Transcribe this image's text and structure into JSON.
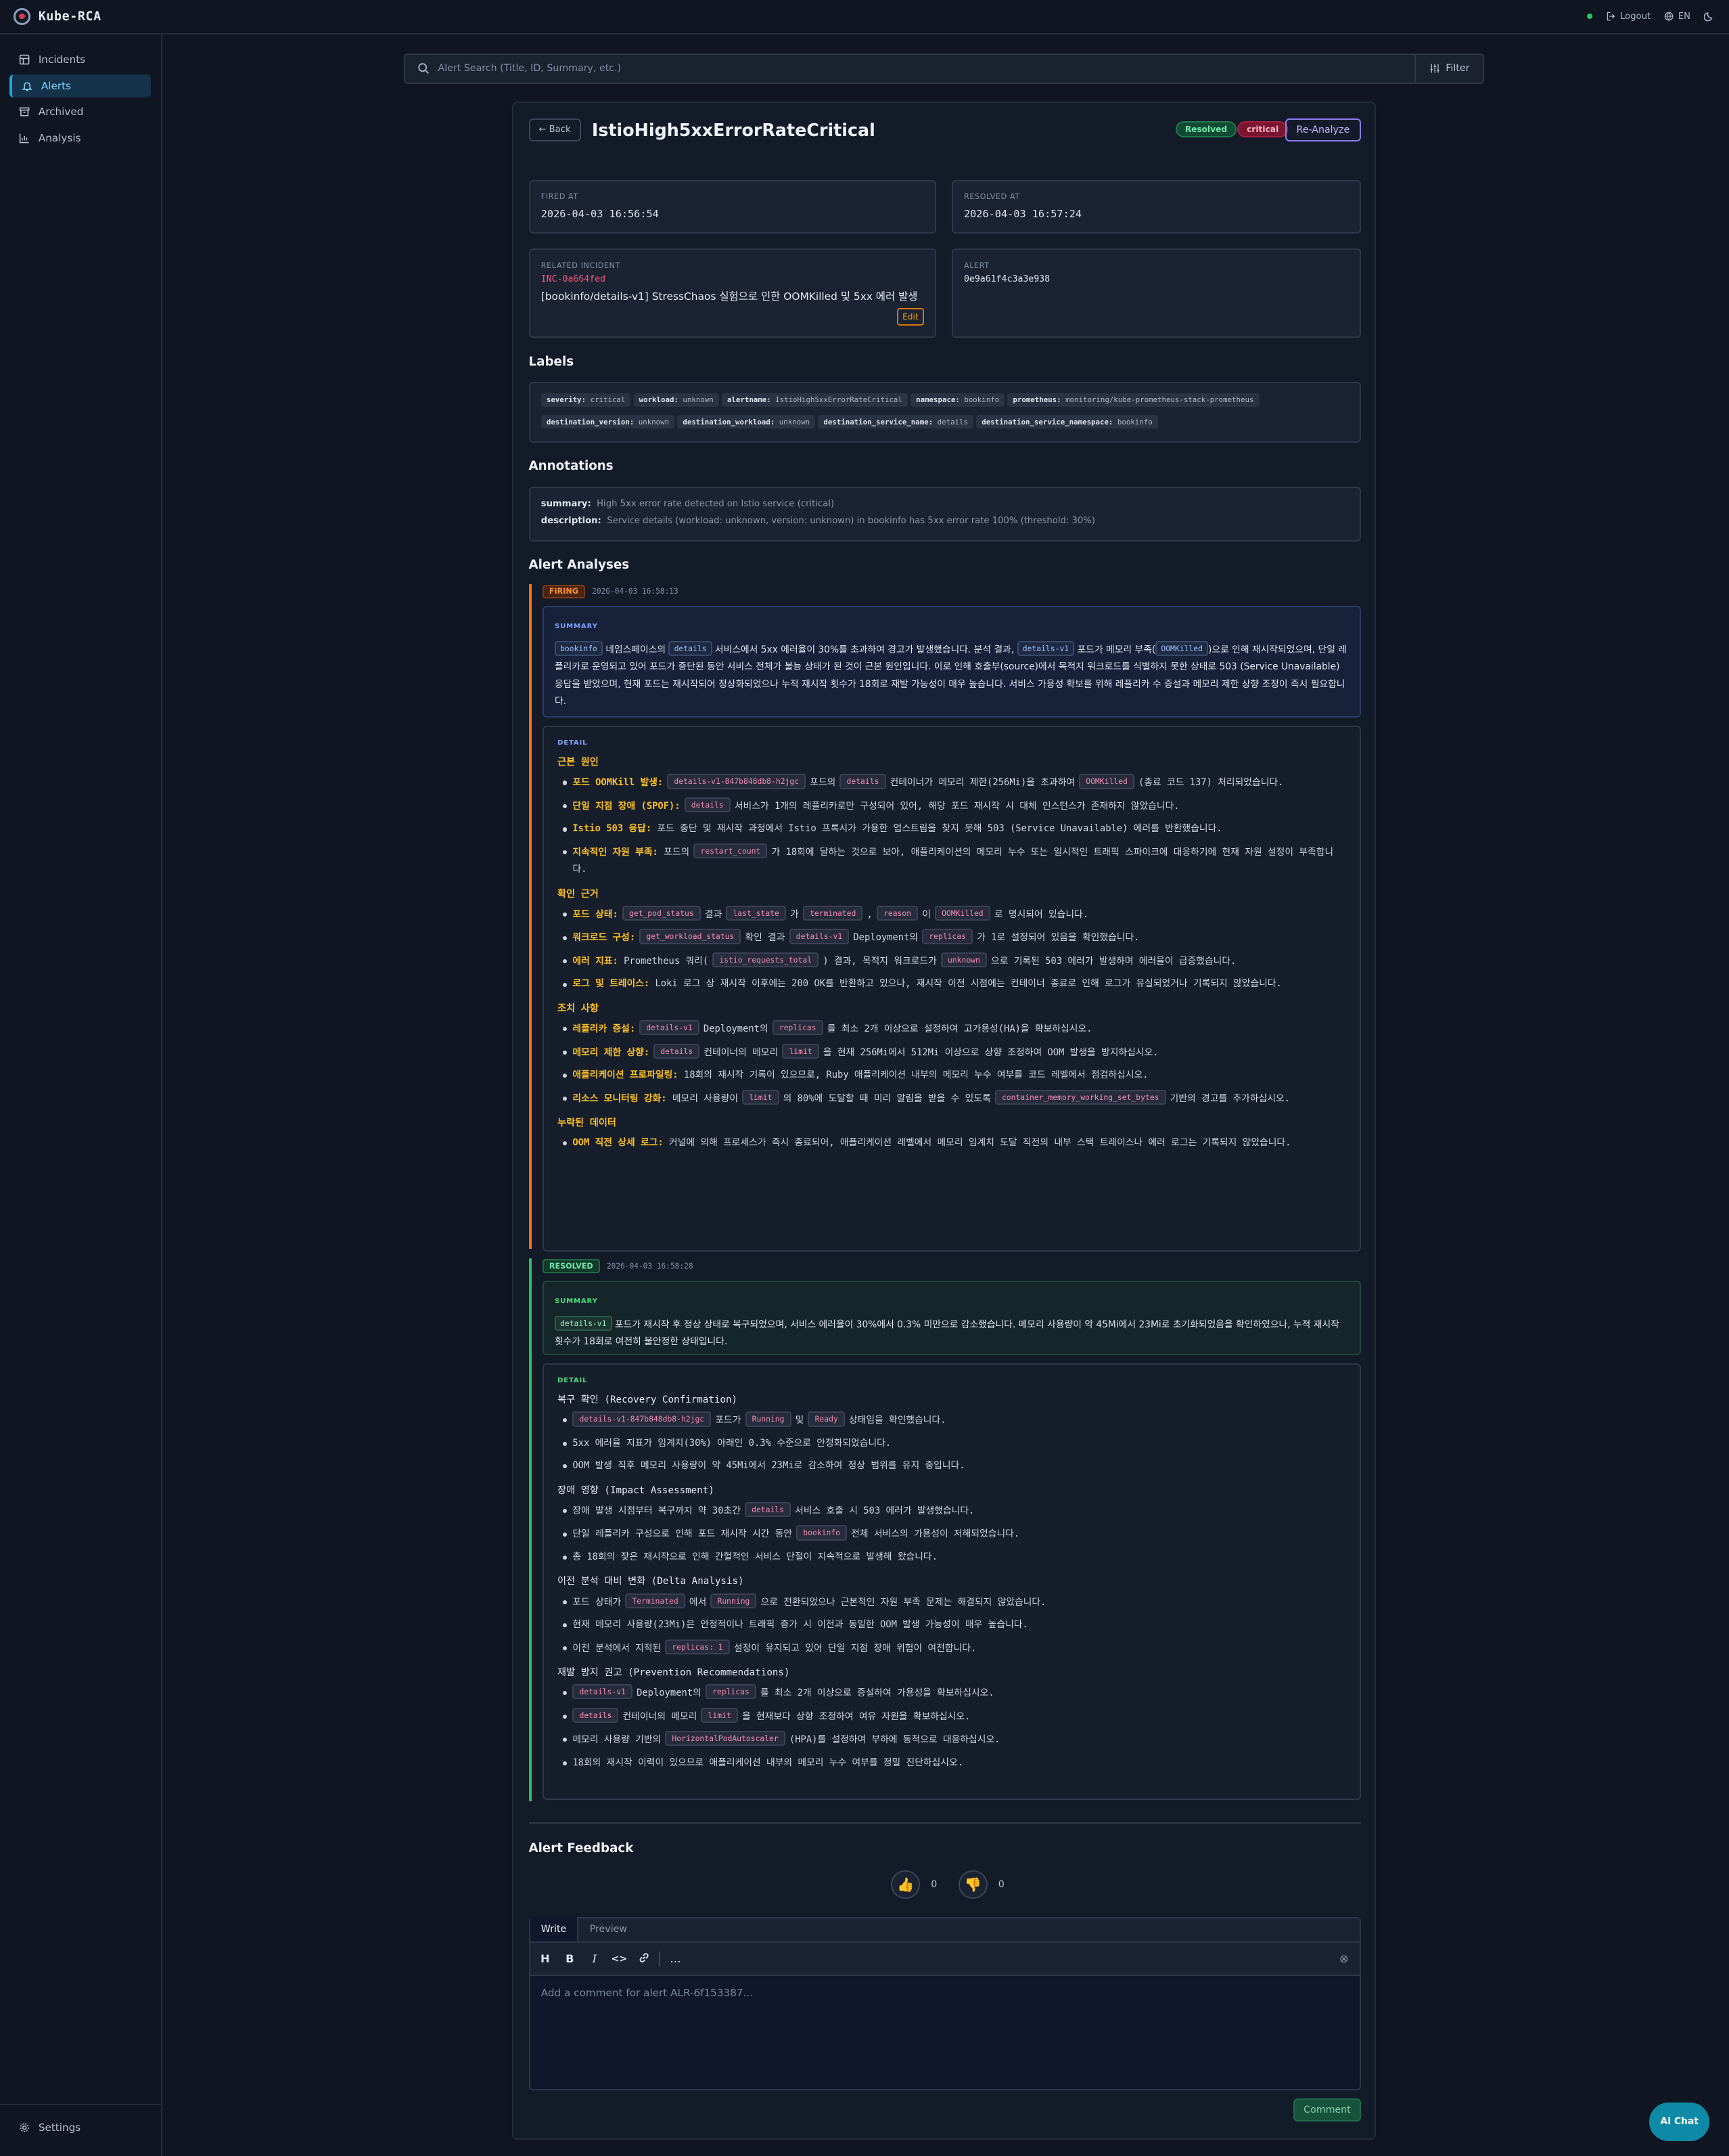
{
  "app": {
    "brand": "Kube-RCA",
    "logout": "Logout",
    "lang": "EN"
  },
  "sidebar": {
    "items": [
      {
        "label": "Incidents",
        "icon": "grid-icon"
      },
      {
        "label": "Alerts",
        "icon": "bell-icon"
      },
      {
        "label": "Archived",
        "icon": "archive-icon"
      },
      {
        "label": "Analysis",
        "icon": "chart-icon"
      }
    ],
    "settings": "Settings"
  },
  "search": {
    "placeholder": "Alert Search (Title, ID, Summary, etc.)",
    "filter": "Filter"
  },
  "alert": {
    "back": "Back",
    "title": "IstioHigh5xxErrorRateCritical",
    "status": "Resolved",
    "severity": "critical",
    "reanalyze": "Re-Analyze",
    "fired_label": "FIRED AT",
    "fired_at": "2026-04-03 16:56:54",
    "resolved_label": "RESOLVED AT",
    "resolved_at": "2026-04-03 16:57:24",
    "incident_label": "RELATED INCIDENT",
    "incident_id": "INC-0a664fed",
    "incident_title": "[bookinfo/details-v1] StressChaos 실험으로 인한 OOMKilled 및 5xx 에러 발생",
    "edit": "Edit",
    "alert_label": "ALERT",
    "alert_id": "0e9a61f4c3a3e938"
  },
  "labels": {
    "heading": "Labels",
    "items": [
      {
        "k": "severity:",
        "v": "critical"
      },
      {
        "k": "workload:",
        "v": "unknown"
      },
      {
        "k": "alertname:",
        "v": "IstioHigh5xxErrorRateCritical"
      },
      {
        "k": "namespace:",
        "v": "bookinfo"
      },
      {
        "k": "prometheus:",
        "v": "monitoring/kube-prometheus-stack-prometheus"
      },
      {
        "k": "destination_version:",
        "v": "unknown"
      },
      {
        "k": "destination_workload:",
        "v": "unknown"
      },
      {
        "k": "destination_service_name:",
        "v": "details"
      },
      {
        "k": "destination_service_namespace:",
        "v": "bookinfo"
      }
    ]
  },
  "annotations": {
    "heading": "Annotations",
    "summary_k": "summary:",
    "summary_v": "High 5xx error rate detected on Istio service (critical)",
    "desc_k": "description:",
    "desc_v": "Service details (workload: unknown, version: unknown) in bookinfo has 5xx error rate 100% (threshold: 30%)"
  },
  "analyses": {
    "heading": "Alert Analyses",
    "summary_label": "SUMMARY",
    "detail_label": "DETAIL",
    "a1": {
      "state": "FIRING",
      "ts": "2026-04-03 16:58:13",
      "sum": [
        "bookinfo",
        " 네임스페이스의 ",
        "details",
        " 서비스에서 5xx 에러율이 30%를 초과하여 경고가 발생했습니다. 분석 결과, ",
        "details-v1",
        " 포드가 메모리 부족(",
        "OOMKilled",
        ")으로 인해 재시작되었으며, 단일 레플리카로 운영되고 있어 포드가 중단된 동안 서비스 전체가 불능 상태가 된 것이 근본 원인입니다. 이로 인해 호출부(source)에서 목적지 워크로드를 식별하지 못한 상태로 503 (Service Unavailable) 응답을 받았으며, 현재 포드는 재시작되어 정상화되었으나 누적 재시작 횟수가 18회로 재발 가능성이 매우 높습니다. 서비스 가용성 확보를 위해 레플리카 수 증설과 메모리 제한 상향 조정이 즉시 필요합니다."
      ],
      "h1": "근본 원인",
      "r1": [
        "포드 OOMKill 발생:",
        "details-v1-847b848db8-h2jgc",
        "포드의",
        "details",
        "컨테이너가 메모리 제한(256Mi)을 초과하여",
        "OOMKilled",
        "(종료 코드 137) 처리되었습니다."
      ],
      "r2": [
        "단일 지점 장애 (SPOF):",
        "details",
        "서비스가 1개의 레플리카로만 구성되어 있어, 해당 포드 재시작 시 대체 인스턴스가 존재하지 않았습니다."
      ],
      "r3": [
        "Istio 503 응답:",
        "포드 중단 및 재시작 과정에서 Istio 프록시가 가용한 업스트림을 찾지 못해 503 (Service Unavailable) 에러를 반환했습니다."
      ],
      "r4": [
        "지속적인 자원 부족:",
        "포드의",
        "restart_count",
        "가 18회에 달하는 것으로 보아, 애플리케이션의 메모리 누수 또는 일시적인 트래픽 스파이크에 대응하기에 현재 자원 설정이 부족합니다."
      ],
      "h2": "확인 근거",
      "e1": [
        "포드 상태:",
        "get_pod_status",
        "결과",
        "last_state",
        "가",
        "terminated",
        ",",
        "reason",
        "이",
        "OOMKilled",
        "로 명시되어 있습니다."
      ],
      "e2": [
        "워크로드 구성:",
        "get_workload_status",
        "확인 결과",
        "details-v1",
        "Deployment의",
        "replicas",
        "가 1로 설정되어 있음을 확인했습니다."
      ],
      "e3": [
        "에러 지표:",
        "Prometheus 쿼리(",
        "istio_requests_total",
        ") 결과, 목적지 워크로드가",
        "unknown",
        "으로 기록된 503 에러가 발생하며 에러율이 급증했습니다."
      ],
      "e4": [
        "로그 및 트레이스:",
        "Loki 로그 상 재시작 이후에는 200 OK를 반환하고 있으나, 재시작 이전 시점에는 컨테이너 종료로 인해 로그가 유실되었거나 기록되지 않았습니다."
      ],
      "h3": "조치 사항",
      "m1": [
        "레플리카 증설:",
        "details-v1",
        "Deployment의",
        "replicas",
        "를 최소 2개 이상으로 설정하여 고가용성(HA)을 확보하십시오."
      ],
      "m2": [
        "메모리 제한 상향:",
        "details",
        "컨테이너의 메모리",
        "limit",
        "을 현재 256Mi에서 512Mi 이상으로 상향 조정하여 OOM 발생을 방지하십시오."
      ],
      "m3": [
        "애플리케이션 프로파일링:",
        "18회의 재시작 기록이 있으므로, Ruby 애플리케이션 내부의 메모리 누수 여부를 코드 레벨에서 점검하십시오."
      ],
      "m4": [
        "리소스 모니터링 강화:",
        "메모리 사용량이",
        "limit",
        "의 80%에 도달할 때 미리 알림을 받을 수 있도록",
        "container_memory_working_set_bytes",
        "기반의 경고를 추가하십시오."
      ],
      "h4": "누락된 데이터",
      "n1": [
        "OOM 직전 상세 로그:",
        "커널에 의해 프로세스가 즉시 종료되어, 애플리케이션 레벨에서 메모리 임계치 도달 직전의 내부 스택 트레이스나 에러 로그는 기록되지 않았습니다."
      ]
    },
    "a2": {
      "state": "RESOLVED",
      "ts": "2026-04-03 16:58:28",
      "sum": [
        "details-v1",
        " 포드가 재시작 후 정상 상태로 복구되었으며, 서비스 에러율이 30%에서 0.3% 미만으로 감소했습니다. 메모리 사용량이 약 45Mi에서 23Mi로 초기화되었음을 확인하였으나, 누적 재시작 횟수가 18회로 여전히 불안정한 상태입니다."
      ],
      "h1": "복구 확인 (Recovery Confirmation)",
      "r1": [
        "details-v1-847b848db8-h2jgc",
        "포드가",
        "Running",
        "및",
        "Ready",
        "상태임을 확인했습니다."
      ],
      "r2": "5xx 에러율 지표가 임계치(30%) 아래인 0.3% 수준으로 안정화되었습니다.",
      "r3": "OOM 발생 직후 메모리 사용량이 약 45Mi에서 23Mi로 감소하여 정상 범위를 유지 중입니다.",
      "h2": "장애 영향 (Impact Assessment)",
      "i1": [
        "장애 발생 시점부터 복구까지 약 30초간",
        "details",
        "서비스 호출 시 503 에러가 발생했습니다."
      ],
      "i2": [
        "단일 레플리카 구성으로 인해 포드 재시작 시간 동안",
        "bookinfo",
        "전체 서비스의 가용성이 저해되었습니다."
      ],
      "i3": "총 18회의 잦은 재시작으로 인해 간헐적인 서비스 단절이 지속적으로 발생해 왔습니다.",
      "h3": "이전 분석 대비 변화 (Delta Analysis)",
      "d1": [
        "포드 상태가",
        "Terminated",
        "에서",
        "Running",
        "으로 전환되었으나 근본적인 자원 부족 문제는 해결되지 않았습니다."
      ],
      "d2": "현재 메모리 사용량(23Mi)은 안정적이나 트래픽 증가 시 이전과 동일한 OOM 발생 가능성이 매우 높습니다.",
      "d3": [
        "이전 분석에서 지적된",
        "replicas: 1",
        "설정이 유지되고 있어 단일 지점 장애 위험이 여전합니다."
      ],
      "h4": "재발 방지 권고 (Prevention Recommendations)",
      "p1": [
        "details-v1",
        "Deployment의",
        "replicas",
        "를 최소 2개 이상으로 증설하여 가용성을 확보하십시오."
      ],
      "p2": [
        "details",
        "컨테이너의 메모리",
        "limit",
        "을 현재보다 상향 조정하여 여유 자원을 확보하십시오."
      ],
      "p3": [
        "메모리 사용량 기반의",
        "HorizontalPodAutoscaler",
        "(HPA)를 설정하여 부하에 동적으로 대응하십시오."
      ],
      "p4": "18회의 재시작 이력이 있으므로 애플리케이션 내부의 메모리 누수 여부를 정밀 진단하십시오."
    }
  },
  "feedback": {
    "heading": "Alert Feedback",
    "up_count": "0",
    "down_count": "0",
    "tab_write": "Write",
    "tab_preview": "Preview",
    "placeholder": "Add a comment for alert ALR-6f153387...",
    "comment": "Comment"
  },
  "aichat": "AI Chat",
  "colors": {
    "accent": "#22a4d4",
    "critical": "#a51f44",
    "resolved": "#1f7a50",
    "firing": "#f97316",
    "reanalyze": "#8b7cf6"
  }
}
